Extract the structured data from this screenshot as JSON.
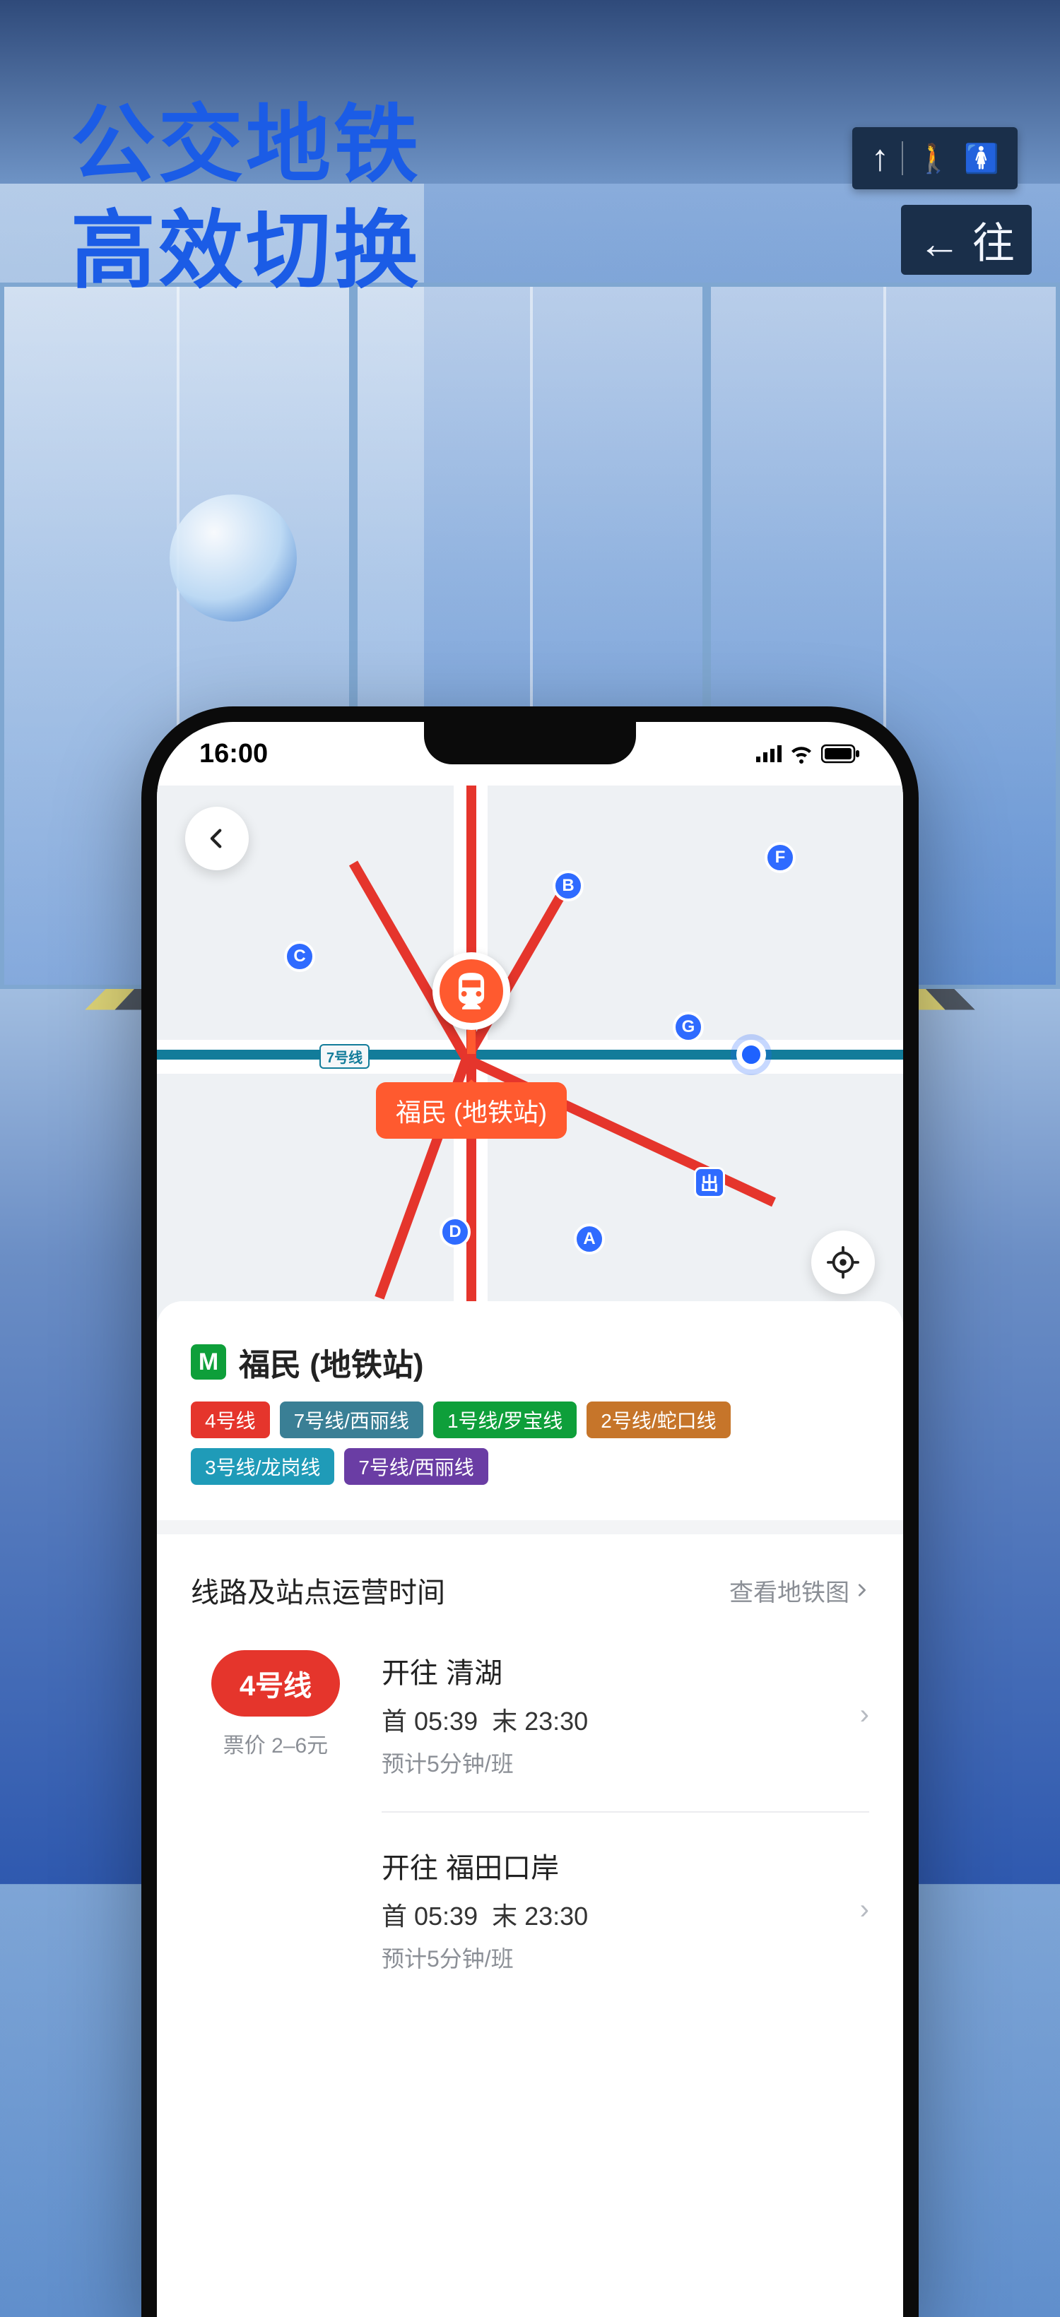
{
  "headline": {
    "line1": "公交地铁",
    "line2": "高效切换"
  },
  "background_signs": {
    "arrow_right": "← 往"
  },
  "statusbar": {
    "time": "16:00"
  },
  "map": {
    "line7_tag": "7号线",
    "station_label": "福民 (地铁站)",
    "exits": {
      "B": "B",
      "C": "C",
      "D": "D",
      "A": "A",
      "F": "F",
      "G": "G",
      "chu": "出"
    }
  },
  "sheet": {
    "station_name": "福民 (地铁站)",
    "line_badges": [
      {
        "label": "4号线",
        "color": "#e5352c"
      },
      {
        "label": "7号线/西丽线",
        "color": "#3a7f95"
      },
      {
        "label": "1号线/罗宝线",
        "color": "#0e9f3a"
      },
      {
        "label": "2号线/蛇口线",
        "color": "#c6752a"
      },
      {
        "label": "3号线/龙岗线",
        "color": "#1f9bb8"
      },
      {
        "label": "7号线/西丽线",
        "color": "#6a3da4"
      }
    ],
    "section_title": "线路及站点运营时间",
    "section_link": "查看地铁图",
    "line_pill": "4号线",
    "fare": "票价 2–6元",
    "schedules": [
      {
        "dest": "开往 清湖",
        "first": "首 05:39",
        "last": "末 23:30",
        "freq": "预计5分钟/班"
      },
      {
        "dest": "开往 福田口岸",
        "first": "首 05:39",
        "last": "末 23:30",
        "freq": "预计5分钟/班"
      }
    ]
  }
}
